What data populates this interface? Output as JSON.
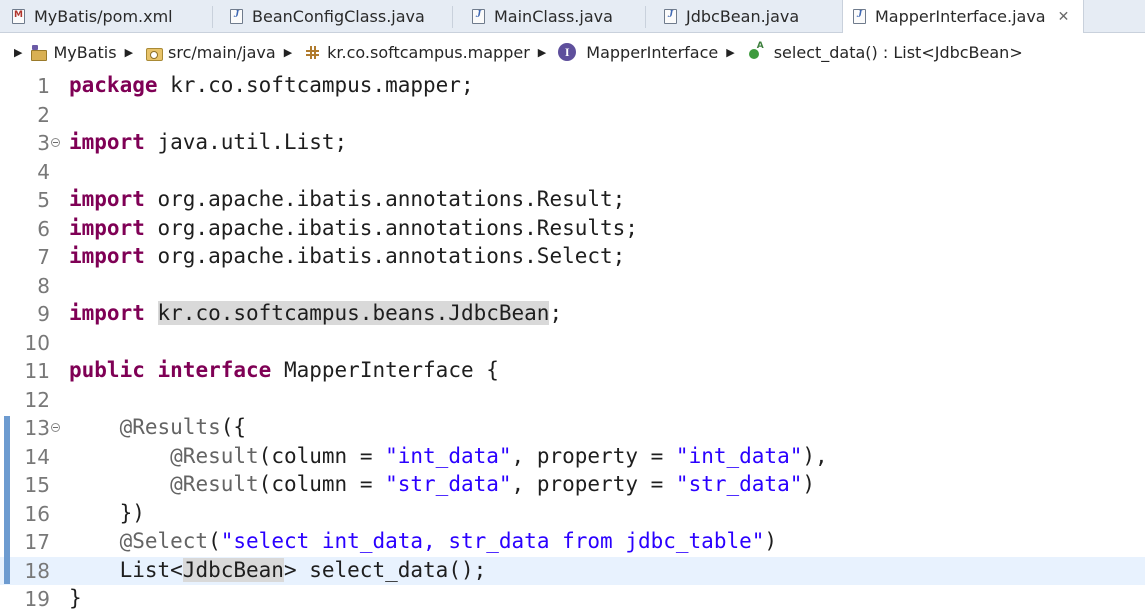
{
  "tabs": [
    {
      "label": "MyBatis/pom.xml",
      "icon": "maven-pom-file-icon",
      "active": false
    },
    {
      "label": "BeanConfigClass.java",
      "icon": "java-file-icon",
      "active": false
    },
    {
      "label": "MainClass.java",
      "icon": "java-file-icon",
      "active": false
    },
    {
      "label": "JdbcBean.java",
      "icon": "java-file-icon",
      "active": false
    },
    {
      "label": "MapperInterface.java",
      "icon": "java-file-icon",
      "active": true
    }
  ],
  "breadcrumb": {
    "project": "MyBatis",
    "source_folder": "src/main/java",
    "package": "kr.co.softcampus.mapper",
    "type": "MapperInterface",
    "method": "select_data() : List<JdbcBean>"
  },
  "editor": {
    "current_line": 18,
    "lines": [
      {
        "n": "1",
        "code": "package kr.co.softcampus.mapper;"
      },
      {
        "n": "2",
        "code": ""
      },
      {
        "n": "3",
        "code": "import java.util.List;",
        "fold": true
      },
      {
        "n": "4",
        "code": ""
      },
      {
        "n": "5",
        "code": "import org.apache.ibatis.annotations.Result;"
      },
      {
        "n": "6",
        "code": "import org.apache.ibatis.annotations.Results;"
      },
      {
        "n": "7",
        "code": "import org.apache.ibatis.annotations.Select;"
      },
      {
        "n": "8",
        "code": ""
      },
      {
        "n": "9",
        "code": "import kr.co.softcampus.beans.JdbcBean;"
      },
      {
        "n": "10",
        "code": ""
      },
      {
        "n": "11",
        "code": "public interface MapperInterface {"
      },
      {
        "n": "12",
        "code": ""
      },
      {
        "n": "13",
        "code": "    @Results({",
        "fold": true
      },
      {
        "n": "14",
        "code": "        @Result(column = \"int_data\", property = \"int_data\"),"
      },
      {
        "n": "15",
        "code": "        @Result(column = \"str_data\", property = \"str_data\")"
      },
      {
        "n": "16",
        "code": "    })"
      },
      {
        "n": "17",
        "code": "    @Select(\"select int_data, str_data from jdbc_table\")"
      },
      {
        "n": "18",
        "code": "    List<JdbcBean> select_data();"
      },
      {
        "n": "19",
        "code": "}"
      }
    ]
  },
  "colors": {
    "keyword": "#7f0055",
    "string": "#2a00ff",
    "annotation": "#646464",
    "current_line": "#e8f2fe",
    "change_bar": "#6d9bd0"
  }
}
